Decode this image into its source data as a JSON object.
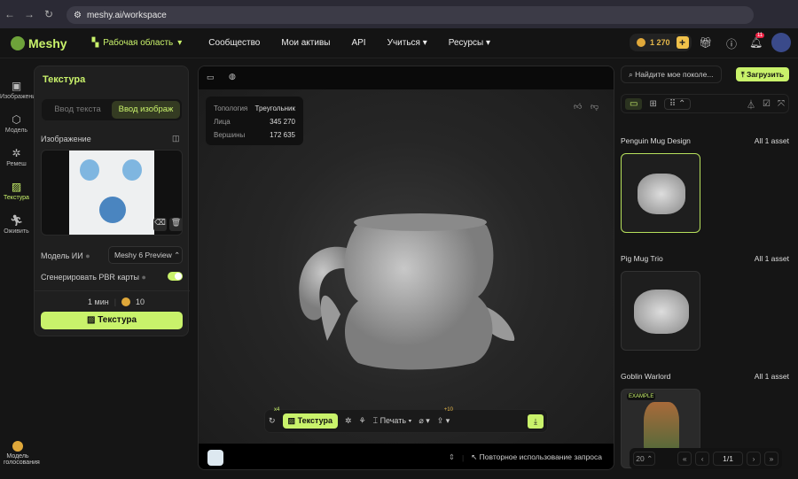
{
  "browser": {
    "url": "meshy.ai/workspace"
  },
  "nav": {
    "logo": "Meshy",
    "workspace": "Рабочая область",
    "items": [
      "Сообщество",
      "Мои активы",
      "API",
      "Учиться",
      "Ресурсы"
    ],
    "credits": "1 270",
    "notifications": "11"
  },
  "rail": [
    {
      "label": "Изображение",
      "icon": "image-icon"
    },
    {
      "label": "Модель",
      "icon": "cube-icon"
    },
    {
      "label": "Ремеш",
      "icon": "remesh-icon"
    },
    {
      "label": "Текстура",
      "icon": "texture-icon"
    },
    {
      "label": "Оживить",
      "icon": "run-icon"
    }
  ],
  "rail_bottom": "Модель голосования",
  "panel": {
    "title": "Текстура",
    "tabs": [
      "Ввод текста",
      "Ввод изображ"
    ],
    "image_label": "Изображение",
    "model_label": "Модель ИИ",
    "model_value": "Meshy 6 Preview",
    "pbr_label": "Сгенерировать PBR карты",
    "pbr_on": true,
    "time": "1 мин",
    "cost": "10",
    "button": "Текстура"
  },
  "viewer": {
    "stats": [
      {
        "k": "Топология",
        "v": "Треугольник"
      },
      {
        "k": "Лица",
        "v": "345 270"
      },
      {
        "k": "Вершины",
        "v": "172 635"
      }
    ],
    "retry_badge": "x4",
    "texture": "Текстура",
    "print": "Печать",
    "share_badge": "+10",
    "reuse": "Повторное использование запроса"
  },
  "right": {
    "search_placeholder": "Найдите мое поколе...",
    "upload": "Загрузить",
    "groups": [
      {
        "title": "Penguin Mug Design",
        "count": "All 1 asset"
      },
      {
        "title": "Pig Mug Trio",
        "count": "All 1 asset"
      },
      {
        "title": "Goblin Warlord",
        "count": "All 1 asset",
        "badge": "EXAMPLE"
      }
    ],
    "page_size": "20",
    "page": "1/1"
  },
  "colors": {
    "accent": "#c9f26b",
    "bg": "#151515"
  }
}
